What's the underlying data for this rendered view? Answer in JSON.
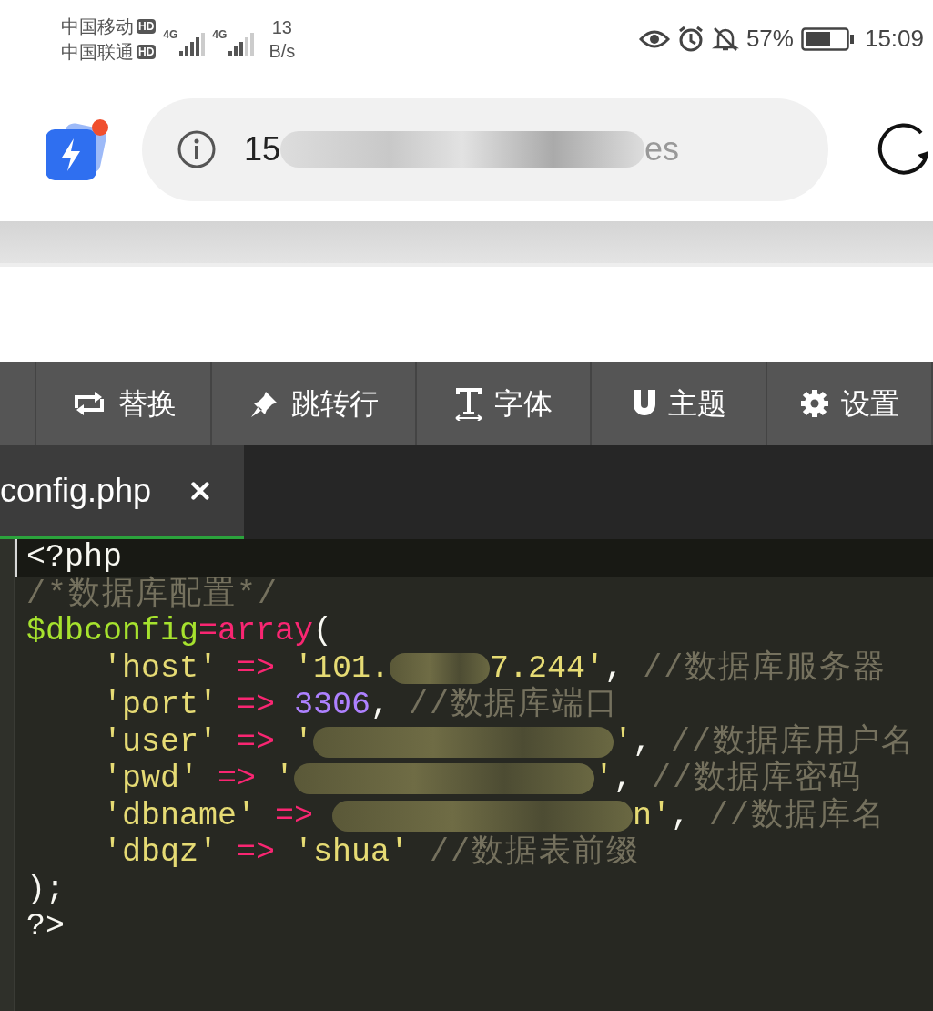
{
  "status_bar": {
    "carriers": [
      {
        "name": "中国移动",
        "badge": "HD"
      },
      {
        "name": "中国联通",
        "badge": "HD"
      }
    ],
    "network_labels": [
      "4G",
      "4G"
    ],
    "speed_value": "13",
    "speed_unit": "B/s",
    "battery_text": "57%",
    "time": "15:09"
  },
  "address_bar": {
    "url_start": "15",
    "url_end": "es",
    "notification_dot": true
  },
  "toolbar": [
    {
      "label": "替换"
    },
    {
      "label": "跳转行"
    },
    {
      "label": "字体"
    },
    {
      "label": "主题"
    },
    {
      "label": "设置"
    }
  ],
  "tabs": [
    {
      "label": "config.php",
      "selected": true
    }
  ],
  "code_lines": [
    {
      "highlighted": true,
      "indent": false,
      "tokens": [
        {
          "kind": "plain",
          "text": "<?php"
        }
      ]
    },
    {
      "highlighted": false,
      "indent": false,
      "tokens": [
        {
          "kind": "comment",
          "text": "/*数据库配置*/"
        }
      ]
    },
    {
      "highlighted": false,
      "indent": false,
      "tokens": [
        {
          "kind": "var",
          "text": "$dbconfig"
        },
        {
          "kind": "op",
          "text": "="
        },
        {
          "kind": "op",
          "text": "array"
        },
        {
          "kind": "plain",
          "text": "("
        }
      ]
    },
    {
      "highlighted": false,
      "indent": true,
      "tokens": [
        {
          "kind": "string",
          "text": "'host'"
        },
        {
          "kind": "op",
          "text": " => "
        },
        {
          "kind": "string",
          "text": "'101."
        },
        {
          "kind": "redacted_short"
        },
        {
          "kind": "string",
          "text": "7.244'"
        },
        {
          "kind": "plain",
          "text": ", "
        },
        {
          "kind": "comment",
          "text": "//数据库服务器"
        }
      ]
    },
    {
      "highlighted": false,
      "indent": true,
      "tokens": [
        {
          "kind": "string",
          "text": "'port'"
        },
        {
          "kind": "op",
          "text": " => "
        },
        {
          "kind": "num",
          "text": "3306"
        },
        {
          "kind": "plain",
          "text": ", "
        },
        {
          "kind": "comment",
          "text": "//数据库端口"
        }
      ]
    },
    {
      "highlighted": false,
      "indent": true,
      "tokens": [
        {
          "kind": "string",
          "text": "'user'"
        },
        {
          "kind": "op",
          "text": " => "
        },
        {
          "kind": "string",
          "text": "'"
        },
        {
          "kind": "redacted_long"
        },
        {
          "kind": "string",
          "text": "'"
        },
        {
          "kind": "plain",
          "text": ", "
        },
        {
          "kind": "comment",
          "text": "//数据库用户名"
        }
      ]
    },
    {
      "highlighted": false,
      "indent": true,
      "tokens": [
        {
          "kind": "string",
          "text": "'pwd'"
        },
        {
          "kind": "op",
          "text": " => "
        },
        {
          "kind": "string",
          "text": "'"
        },
        {
          "kind": "redacted_long"
        },
        {
          "kind": "string",
          "text": "'"
        },
        {
          "kind": "plain",
          "text": ", "
        },
        {
          "kind": "comment",
          "text": "//数据库密码"
        }
      ]
    },
    {
      "highlighted": false,
      "indent": true,
      "tokens": [
        {
          "kind": "string",
          "text": "'dbname'"
        },
        {
          "kind": "op",
          "text": " => "
        },
        {
          "kind": "redacted_long"
        },
        {
          "kind": "string",
          "text": "n'"
        },
        {
          "kind": "plain",
          "text": ", "
        },
        {
          "kind": "comment",
          "text": "//数据库名"
        }
      ]
    },
    {
      "highlighted": false,
      "indent": true,
      "tokens": [
        {
          "kind": "string",
          "text": "'dbqz'"
        },
        {
          "kind": "op",
          "text": " => "
        },
        {
          "kind": "string",
          "text": "'shua'"
        },
        {
          "kind": "comment",
          "text": " //数据表前缀"
        }
      ]
    },
    {
      "highlighted": false,
      "indent": false,
      "tokens": [
        {
          "kind": "plain",
          "text": ");"
        }
      ]
    },
    {
      "highlighted": false,
      "indent": false,
      "tokens": [
        {
          "kind": "plain",
          "text": "?>"
        }
      ]
    }
  ]
}
